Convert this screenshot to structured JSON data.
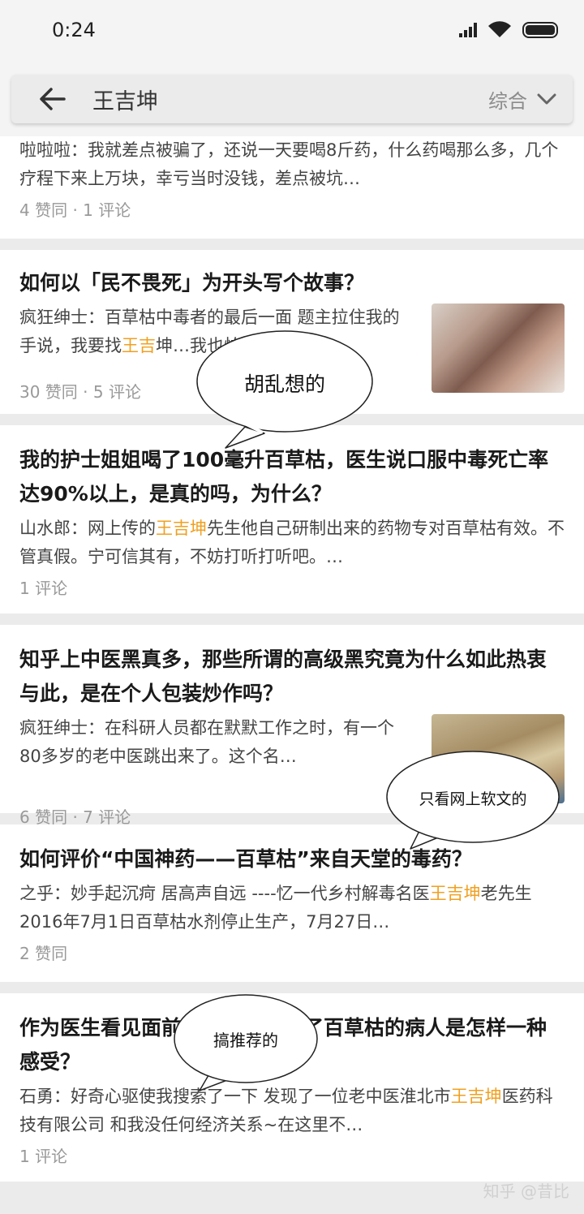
{
  "status": {
    "time": "0:24"
  },
  "search": {
    "query": "王吉坤",
    "filter": "综合"
  },
  "cards": [
    {
      "excerpt": "啦啦啦：我就差点被骗了，还说一天要喝8斤药，什么药喝那么多，几个疗程下来上万块，幸亏当时没钱，差点被坑…",
      "meta": "4 赞同 · 1 评论"
    },
    {
      "title": "如何以「民不畏死」为开头写个故事？",
      "excerpt_a": "疯狂绅士：百草枯中毒者的最后一面 题主拉住我的手说，我要找",
      "excerpt_hl": "王吉",
      "excerpt_b": "坤…我也怕…",
      "meta": "30 赞同 · 5 评论"
    },
    {
      "title": "我的护士姐姐喝了100毫升百草枯，医生说口服中毒死亡率达90%以上，是真的吗，为什么？",
      "excerpt_a": "山水郎：网上传的",
      "excerpt_hl": "王吉坤",
      "excerpt_b": "先生他自己研制出来的药物专对百草枯有效。不管真假。宁可信其有，不妨打听打听吧。…",
      "meta": "1 评论"
    },
    {
      "title": "知乎上中医黑真多，那些所谓的高级黑究竟为什么如此热衷与此，是在个人包装炒作吗？",
      "excerpt": "疯狂绅士：在科研人员都在默默工作之时，有一个80多岁的老中医跳出来了。这个名…",
      "meta": "6 赞同 · 7 评论"
    },
    {
      "title": "如何评价“中国神药——百草枯”来自天堂的毒药？",
      "excerpt_a": "之乎：妙手起沉疴 居高声自远 ----忆一代乡村解毒名医",
      "excerpt_hl": "王吉坤",
      "excerpt_b": "老先生 2016年7月1日百草枯水剂停止生产，7月27日…",
      "meta": "2 赞同"
    },
    {
      "title": "作为医生看见面前活蹦乱跳的喝了百草枯的病人是怎样一种感受？",
      "excerpt_a": "石勇：好奇心驱使我搜索了一下 发现了一位老中医淮北市",
      "excerpt_hl": "王吉坤",
      "excerpt_b": "医药科技有限公司 和我没任何经济关系~在这里不…",
      "meta": "1 评论"
    }
  ],
  "bubbles": [
    "胡乱想的",
    "只看网上软文的",
    "搞推荐的"
  ],
  "watermark": "知乎 @昔比"
}
